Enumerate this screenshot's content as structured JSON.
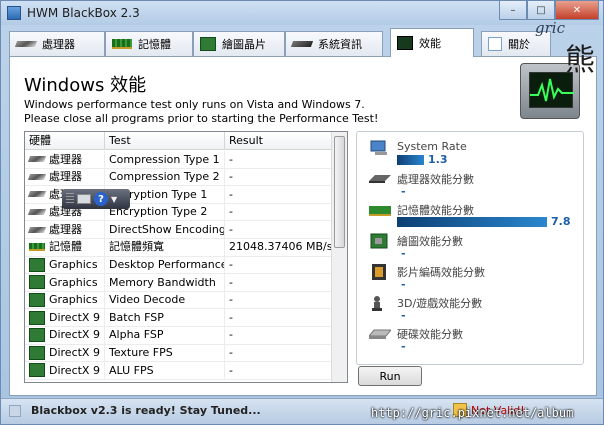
{
  "window": {
    "title": "HWM BlackBox 2.3"
  },
  "tabs": [
    {
      "label": "處理器",
      "icon": "cpu-icon"
    },
    {
      "label": "記憶體",
      "icon": "ram-icon"
    },
    {
      "label": "繪圖晶片",
      "icon": "gpu-icon"
    },
    {
      "label": "系統資訊",
      "icon": "system-icon"
    },
    {
      "label": "效能",
      "icon": "performance-icon",
      "active": true
    },
    {
      "label": "關於",
      "icon": "about-icon"
    }
  ],
  "main": {
    "heading": "Windows 效能",
    "note_line1": "Windows performance test only runs on Vista and Windows 7.",
    "note_line2": "Please close all programs prior to starting the Performance Test!"
  },
  "table": {
    "columns": [
      "硬體",
      "Test",
      "Result"
    ],
    "rows": [
      {
        "hw": "處理器",
        "test": "Compression Type 1",
        "result": "-",
        "icon": "cpu"
      },
      {
        "hw": "處理器",
        "test": "Compression Type 2",
        "result": "-",
        "icon": "cpu"
      },
      {
        "hw": "處理器",
        "test": "Encryption Type 1",
        "result": "-",
        "icon": "cpu"
      },
      {
        "hw": "處理器",
        "test": "Encryption Type 2",
        "result": "-",
        "icon": "cpu"
      },
      {
        "hw": "處理器",
        "test": "DirectShow Encoding",
        "result": "-",
        "icon": "cpu"
      },
      {
        "hw": "記憶體",
        "test": "記憶體頻寬",
        "result": "21048.37406 MB/s",
        "icon": "ram"
      },
      {
        "hw": "Graphics",
        "test": "Desktop Performance",
        "result": "-",
        "icon": "gpu"
      },
      {
        "hw": "Graphics",
        "test": "Memory Bandwidth",
        "result": "-",
        "icon": "gpu"
      },
      {
        "hw": "Graphics",
        "test": "Video Decode",
        "result": "-",
        "icon": "gpu"
      },
      {
        "hw": "DirectX 9",
        "test": "Batch FSP",
        "result": "-",
        "icon": "gpu"
      },
      {
        "hw": "DirectX 9",
        "test": "Alpha FSP",
        "result": "-",
        "icon": "gpu"
      },
      {
        "hw": "DirectX 9",
        "test": "Texture FPS",
        "result": "-",
        "icon": "gpu"
      },
      {
        "hw": "DirectX 9",
        "test": "ALU FPS",
        "result": "-",
        "icon": "gpu"
      }
    ],
    "scroll_fraction": 0.45
  },
  "scores": {
    "system": {
      "label": "System Rate",
      "value": "1.3",
      "fraction": 0.18
    },
    "cpu": {
      "label": "處理器效能分數",
      "value": "-"
    },
    "memory": {
      "label": "記憶體效能分數",
      "value": "7.8",
      "fraction": 1.0
    },
    "graphics": {
      "label": "繪圖效能分數",
      "value": "-"
    },
    "video": {
      "label": "影片編碼效能分數",
      "value": "-"
    },
    "gaming": {
      "label": "3D/遊戲效能分數",
      "value": "-"
    },
    "disk": {
      "label": "硬碟效能分數",
      "value": "-"
    }
  },
  "buttons": {
    "run": "Run"
  },
  "status": {
    "message": "Blackbox v2.3 is ready! Stay Tuned...",
    "right": "Not Valid!"
  },
  "watermark": {
    "brand": "gric",
    "char": "熊",
    "url": "http://gric.pixnet.net/album"
  },
  "colors": {
    "accent": "#1d5ea8",
    "bar_dark": "#0c3f73",
    "bar_light": "#2a86cf"
  }
}
